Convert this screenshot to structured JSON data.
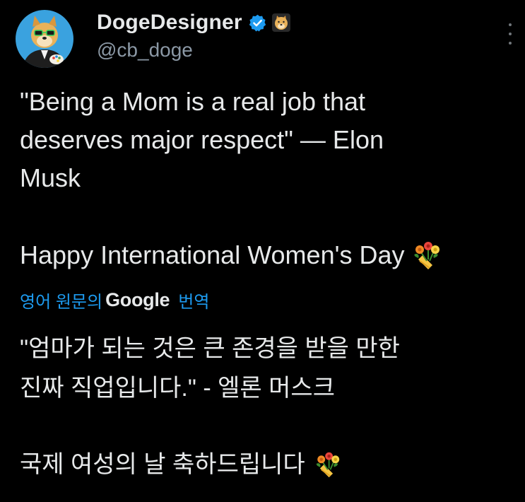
{
  "author": {
    "display_name": "DogeDesigner",
    "handle": "@cb_doge",
    "avatar_icon": "doge-avatar-icon",
    "verified_icon": "verified-badge-icon",
    "badge_icon": "doge-affiliate-icon"
  },
  "tweet": {
    "quote_lines": [
      "\"Being a Mom is a real job that",
      "deserves major respect\" — Elon",
      "Musk"
    ],
    "womens_day": "Happy International Women's Day",
    "emoji": "bouquet-icon"
  },
  "translation": {
    "translated_from": "영어 원문의",
    "provider": "Google",
    "action": "번역",
    "lines": [
      "\"엄마가 되는 것은 큰 존경을 받을 만한",
      "진짜 직업입니다.\" - 엘론 머스크",
      "국제 여성의 날 축하드립니다"
    ]
  },
  "colors": {
    "background": "#000000",
    "text": "#e7e9ea",
    "secondary": "#8b98a5",
    "link": "#1d9bf0",
    "verified": "#1d9bf0"
  }
}
